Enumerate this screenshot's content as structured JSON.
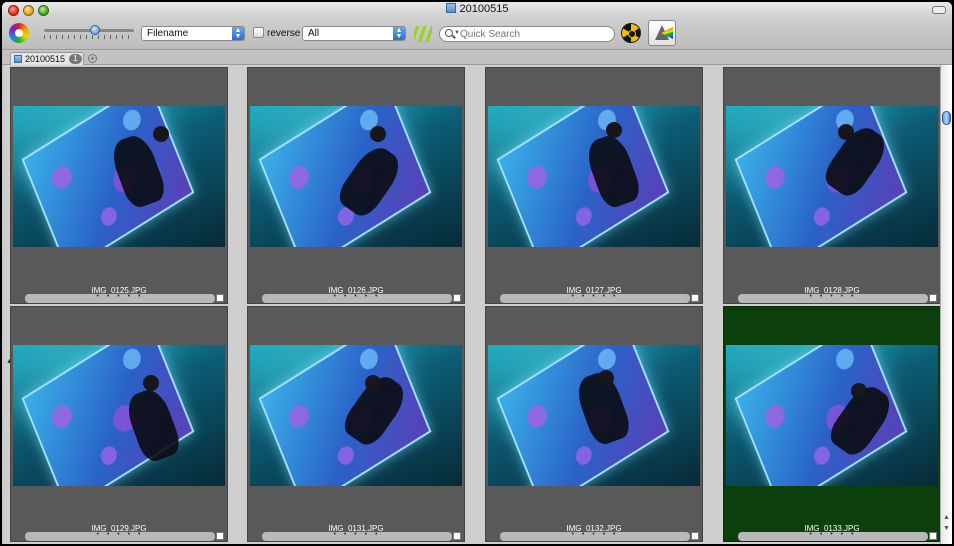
{
  "window": {
    "title": "20100515"
  },
  "toolbar": {
    "sort_select": "Filename",
    "reverse_label": "reverse",
    "filter_select": "All",
    "search_placeholder": "Quick Search"
  },
  "tabs": [
    {
      "label": "20100515",
      "badge": "1"
    }
  ],
  "images": [
    {
      "filename": "IMG_0125.JPG",
      "rating": "• • • • •",
      "selected": false
    },
    {
      "filename": "IMG_0126.JPG",
      "rating": "• • • • •",
      "selected": false
    },
    {
      "filename": "IMG_0127.JPG",
      "rating": "• • • • •",
      "selected": false
    },
    {
      "filename": "IMG_0128.JPG",
      "rating": "• • • • •",
      "selected": false
    },
    {
      "filename": "IMG_0129.JPG",
      "rating": "• • • • •",
      "selected": false
    },
    {
      "filename": "IMG_0131.JPG",
      "rating": "• • • • •",
      "selected": false
    },
    {
      "filename": "IMG_0132.JPG",
      "rating": "• • • • •",
      "selected": false
    },
    {
      "filename": "IMG_0133.JPG",
      "rating": "• • • • •",
      "selected": true
    }
  ],
  "colors": {
    "selected_cell": "#0b3f0b",
    "cell_background": "#595959",
    "accent": "#2a6fcb"
  },
  "icons": {
    "app": "color-wheel-icon",
    "search": "search-icon",
    "nuke": "radiation-icon",
    "prism": "prism-icon",
    "folder": "folder-icon"
  }
}
